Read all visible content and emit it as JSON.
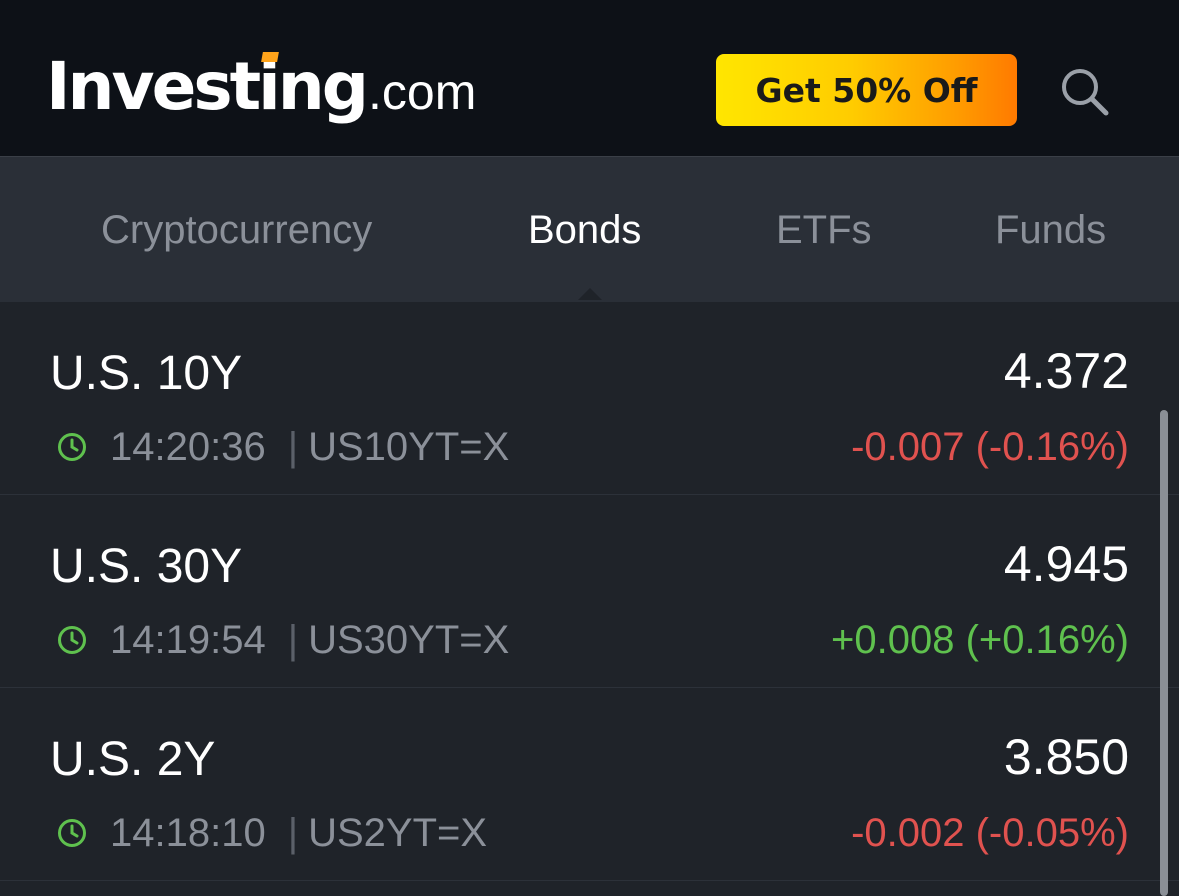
{
  "header": {
    "logo_main": "Investing",
    "logo_suffix": ".com",
    "promo_label": "Get 50% Off",
    "search_icon": "search-icon"
  },
  "tabs": [
    {
      "label": "Cryptocurrency",
      "active": false
    },
    {
      "label": "Bonds",
      "active": true
    },
    {
      "label": "ETFs",
      "active": false
    },
    {
      "label": "Funds",
      "active": false
    }
  ],
  "rows": [
    {
      "name": "U.S. 10Y",
      "price": "4.372",
      "time": "14:20:36",
      "separator": "|",
      "symbol": "US10YT=X",
      "change": "-0.007 (-0.16%)",
      "direction": "down"
    },
    {
      "name": "U.S. 30Y",
      "price": "4.945",
      "time": "14:19:54",
      "separator": "|",
      "symbol": "US30YT=X",
      "change": "+0.008 (+0.16%)",
      "direction": "up"
    },
    {
      "name": "U.S. 2Y",
      "price": "3.850",
      "time": "14:18:10",
      "separator": "|",
      "symbol": "US2YT=X",
      "change": "-0.002 (-0.05%)",
      "direction": "down"
    }
  ],
  "colors": {
    "header_bg": "#0d1117",
    "tabs_bg": "#2a2f37",
    "list_bg": "#1f2329",
    "negative": "#e0524f",
    "positive": "#5fc14e",
    "clock": "#5fc14e",
    "logo_accent": "#ffa41b"
  }
}
